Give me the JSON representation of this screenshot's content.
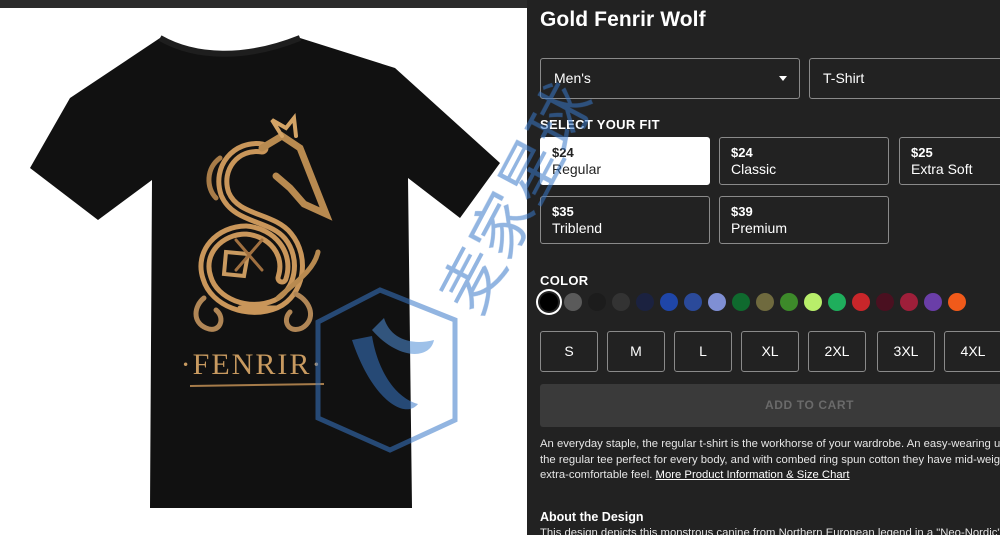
{
  "product": {
    "title": "Gold Fenrir Wolf",
    "artwork_text": "·FENRIR·"
  },
  "selects": {
    "gender": "Men's",
    "type": "T-Shirt"
  },
  "fit": {
    "label": "SELECT YOUR FIT",
    "options": [
      {
        "price": "$24",
        "name": "Regular",
        "selected": true
      },
      {
        "price": "$24",
        "name": "Classic",
        "selected": false
      },
      {
        "price": "$25",
        "name": "Extra Soft",
        "selected": false
      },
      {
        "price": "$35",
        "name": "Triblend",
        "selected": false
      },
      {
        "price": "$39",
        "name": "Premium",
        "selected": false
      }
    ]
  },
  "color": {
    "label": "COLOR",
    "swatches": [
      "#000000",
      "#5a5a5a",
      "#1c1c1c",
      "#333333",
      "#1b2240",
      "#1f46a8",
      "#2b4a9a",
      "#7f8fd4",
      "#0f6a2e",
      "#6f6a3e",
      "#3d8a2a",
      "#b8ee6a",
      "#1fae5c",
      "#c8262a",
      "#4a1020",
      "#9e1f3a",
      "#6a3ea8",
      "#f05a1a"
    ]
  },
  "sizes": [
    "S",
    "M",
    "L",
    "XL",
    "2XL",
    "3XL",
    "4XL"
  ],
  "cart": {
    "add_label": "ADD TO CART"
  },
  "description": {
    "line1": "An everyday staple, the regular t-shirt is the workhorse of your wardrobe. An easy-wearing unise",
    "line2": "the regular tee perfect for every body, and with combed ring spun cotton they have mid-weight fa",
    "line3": "extra-comfortable feel.",
    "link": "More Product Information & Size Chart"
  },
  "about": {
    "title": "About the Design",
    "text": "This design depicts this monstrous canine from Northern European legend in a \"Neo-Nordic\" styl"
  },
  "watermark": {
    "text": "麦家星球"
  }
}
